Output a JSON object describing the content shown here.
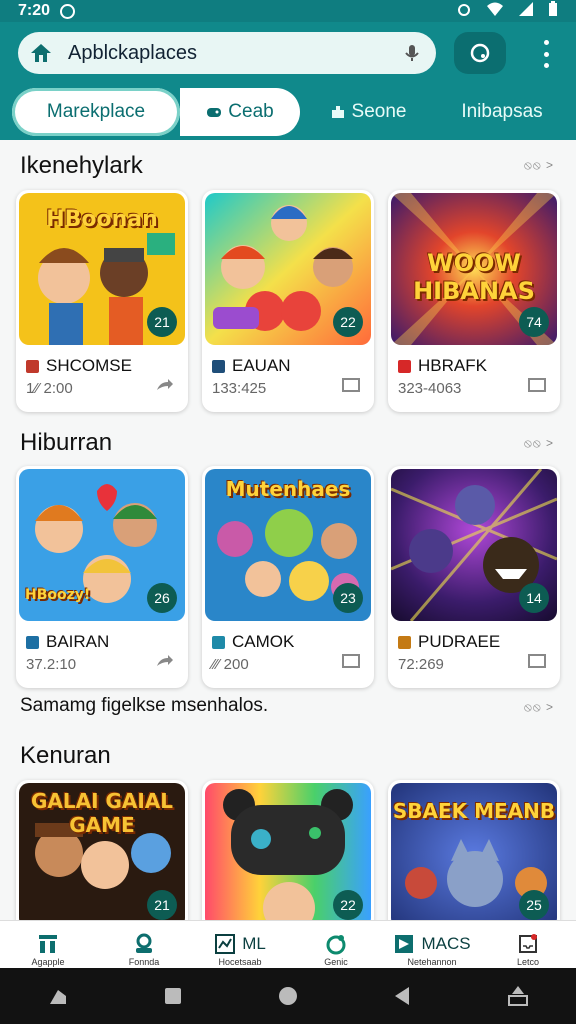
{
  "status": {
    "time": "7:20"
  },
  "search": {
    "text": "Apblckaplaces"
  },
  "tabs": [
    {
      "label": "Marekplace"
    },
    {
      "label": "Ceab"
    },
    {
      "label": "Seone"
    },
    {
      "label": "Inibapsas"
    }
  ],
  "sections": [
    {
      "title": "Ikenehylark",
      "more": "⦸⦸ >"
    },
    {
      "title": "Hiburran",
      "more": "⦸⦸ >"
    },
    {
      "title": "Samamg figelkse msenhalos.",
      "more": "⦸⦸ >"
    },
    {
      "title": "Kenuran",
      "more": ""
    }
  ],
  "cards_row1": [
    {
      "art": "HBoonan",
      "badge": "21",
      "title": "SHCOMSE",
      "meta": "1⁄⁄ 2:00",
      "icon_color": "#c0392b"
    },
    {
      "art": "",
      "badge": "22",
      "title": "EAUAN",
      "meta": "133:425",
      "icon_color": "#1f4e79"
    },
    {
      "art": "WOOW HIBANAS",
      "badge": "74",
      "title": "HBRAFK",
      "meta": "323-4063",
      "icon_color": "#d62828"
    }
  ],
  "cards_row2": [
    {
      "art": "HBoozy!",
      "badge": "26",
      "title": "BAIRAN",
      "meta": "37.2:10",
      "icon_color": "#1d6fa3"
    },
    {
      "art": "Mutenhaes",
      "badge": "23",
      "title": "CAMOK",
      "meta": "⁄⁄⁄ 200",
      "icon_color": "#1f8aa8"
    },
    {
      "art": "",
      "badge": "14",
      "title": "PUDRAEE",
      "meta": "72:269",
      "icon_color": "#c47a14"
    }
  ],
  "cards_row3": [
    {
      "art": "GALAI GAIAL GAME",
      "badge": "21"
    },
    {
      "art": "",
      "badge": "22"
    },
    {
      "art": "SBAEK MEANB",
      "badge": "25"
    }
  ],
  "bottom_nav": [
    {
      "label": "Agapple",
      "text": ""
    },
    {
      "label": "Fonnda",
      "text": ""
    },
    {
      "label": "Hocetsaab",
      "text": "ML"
    },
    {
      "label": "Genic",
      "text": ""
    },
    {
      "label": "Netehannon",
      "text": "MACS"
    },
    {
      "label": "Letco",
      "text": ""
    }
  ],
  "colors": {
    "appbar": "#10898b",
    "statusbar": "#0f7d80",
    "badge": "#0d5c53"
  }
}
